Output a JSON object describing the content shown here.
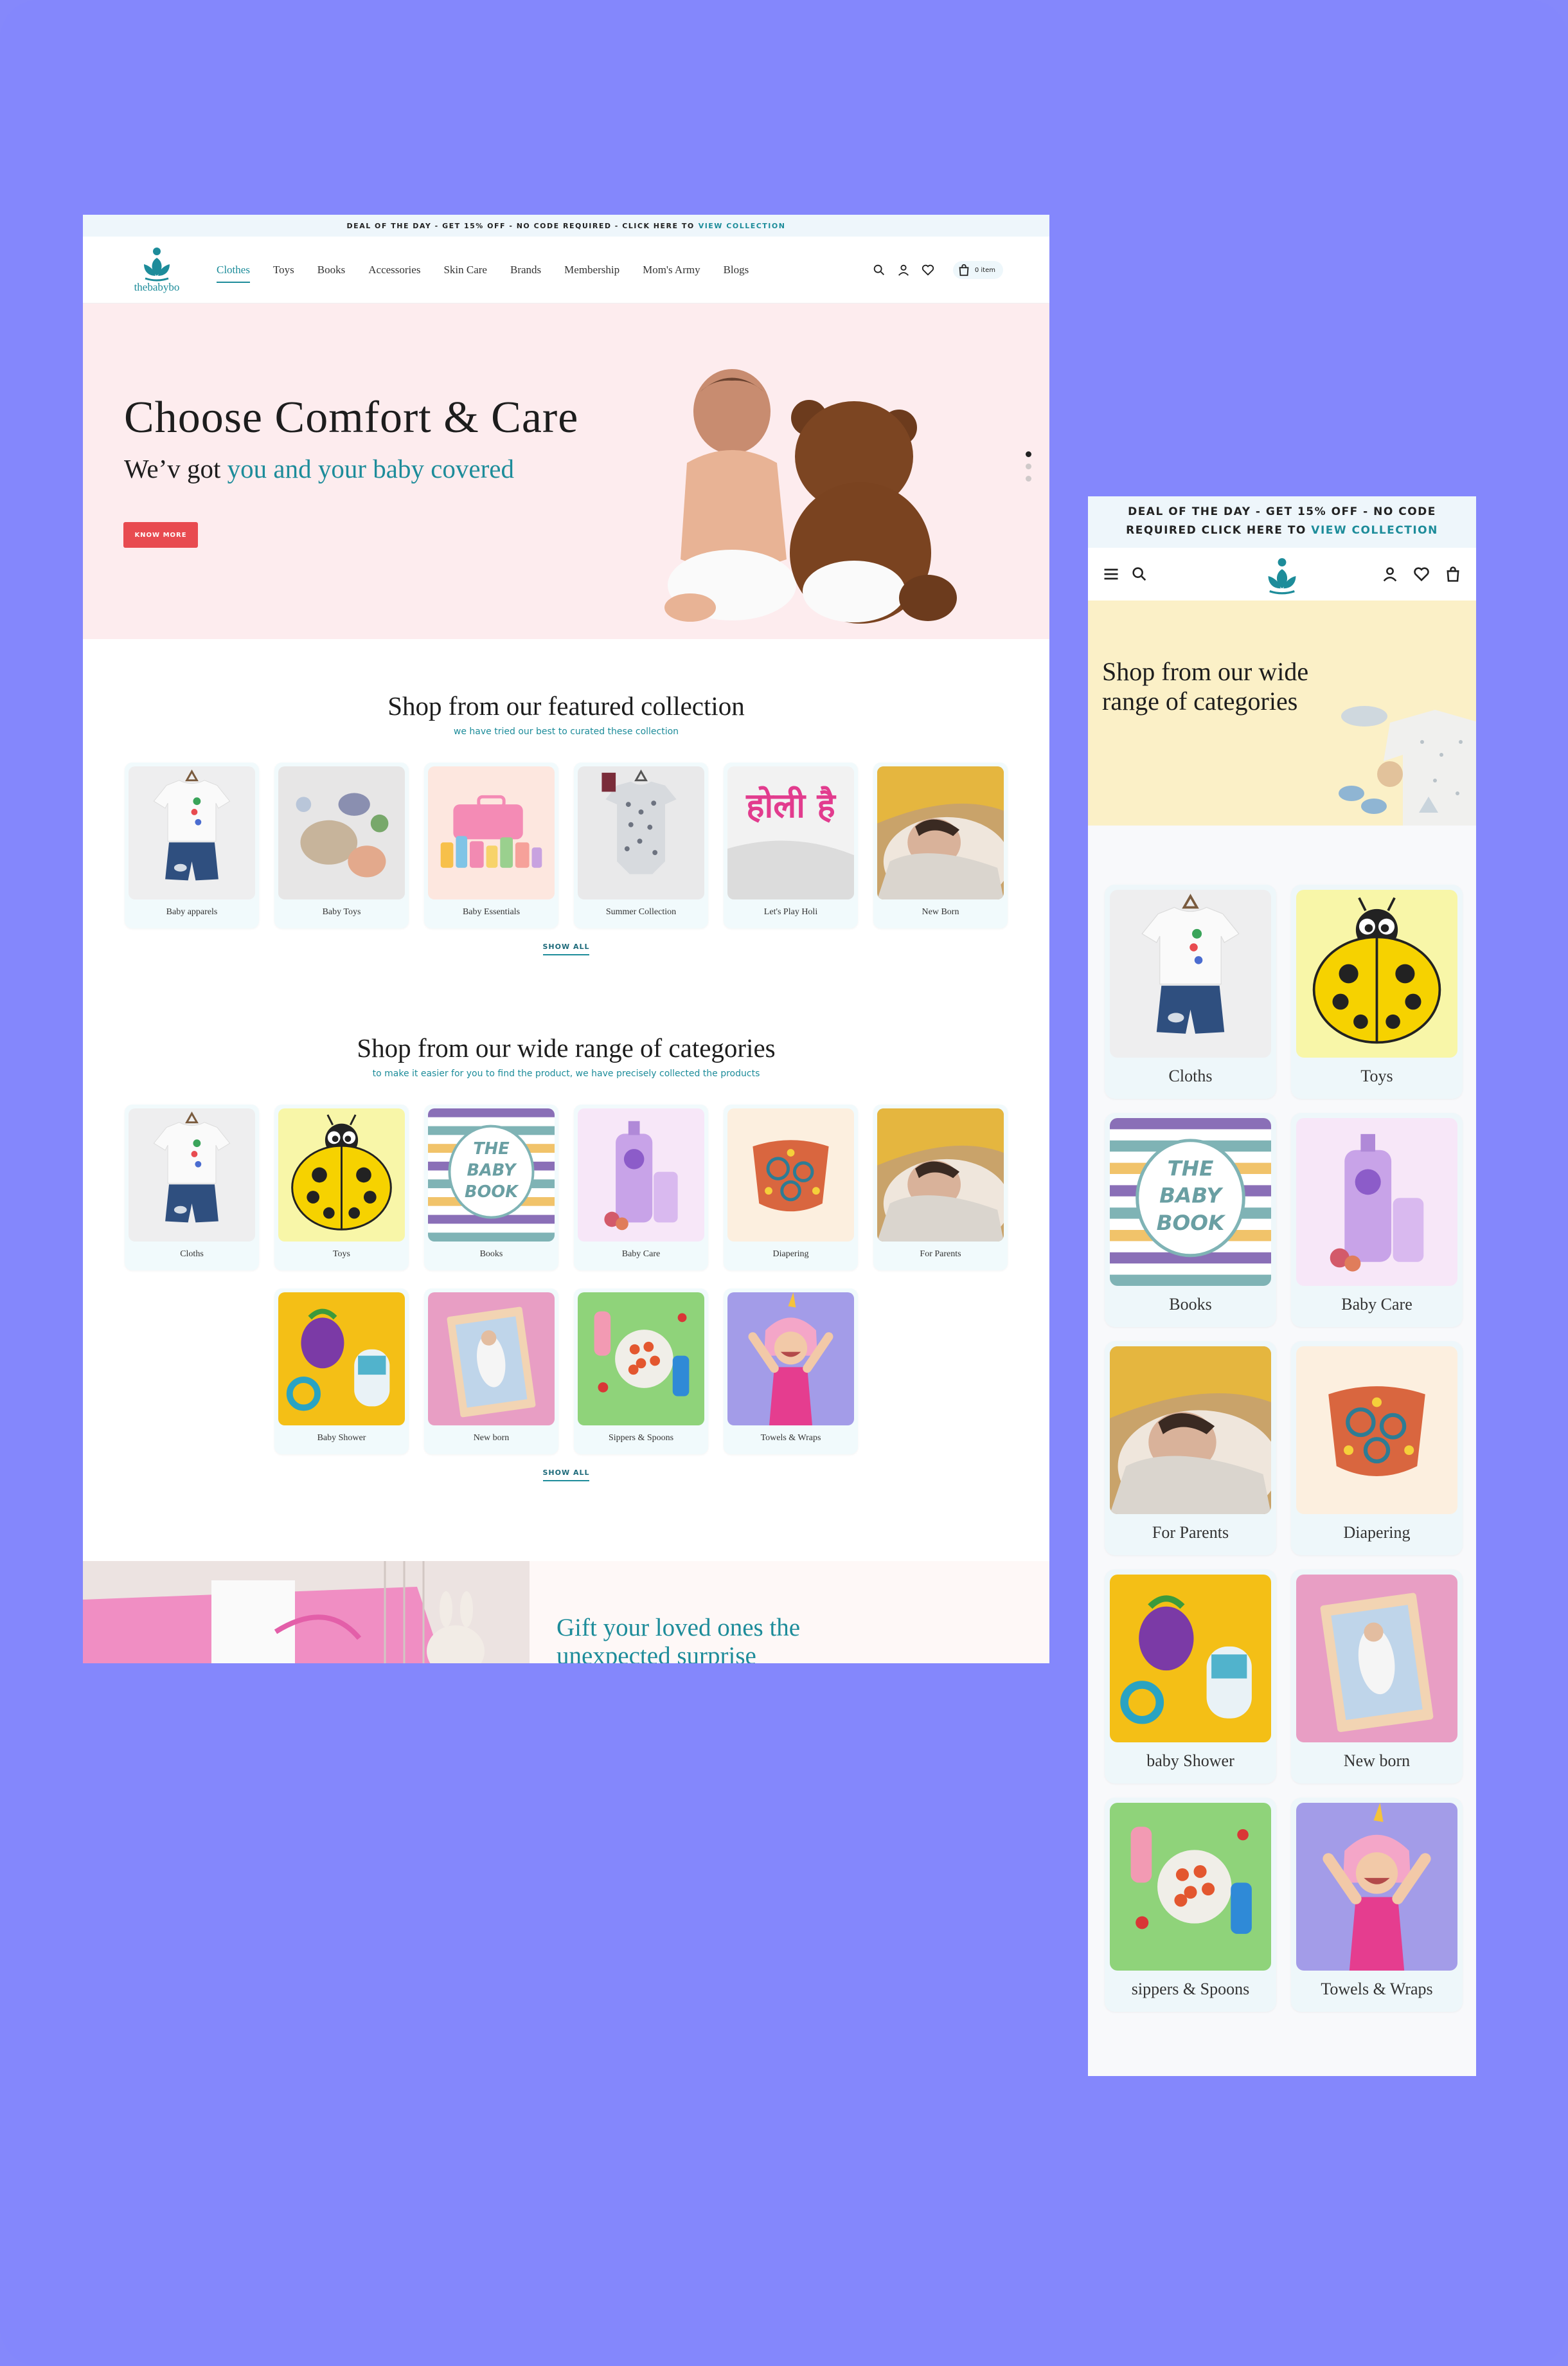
{
  "colors": {
    "background": "#8588fb",
    "brand_teal": "#1d8c9a",
    "cta_red": "#e84b50",
    "hero_pink": "#fdecee",
    "hero_yellow": "#fbf0c7"
  },
  "desktop": {
    "announcement": {
      "text": "DEAL OF THE DAY - GET 15% OFF - NO CODE REQUIRED - CLICK HERE TO",
      "link": "VIEW COLLECTION"
    },
    "logo_text": "thebabybo",
    "nav": [
      "Clothes",
      "Toys",
      "Books",
      "Accessories",
      "Skin Care",
      "Brands",
      "Membership",
      "Mom's Army",
      "Blogs"
    ],
    "cart_label": "0 item",
    "icons": [
      "search-icon",
      "user-icon",
      "heart-icon",
      "bag-icon"
    ],
    "hero": {
      "title": "Choose Comfort & Care",
      "subtitle_lead": "We’v got",
      "subtitle_highlight": "you and your baby covered",
      "cta": "KNOW MORE"
    },
    "featured": {
      "title": "Shop from our featured collection",
      "subtitle": "we have tried our best to curated these collection",
      "items": [
        "Baby apparels",
        "Baby Toys",
        "Baby Essentials",
        "Summer Collection",
        "Let's Play Holi",
        "New Born"
      ],
      "show_all": "SHOW ALL"
    },
    "categories": {
      "title": "Shop from our wide range of categories",
      "subtitle": "to make it easier for you to find the product, we have precisely collected the products",
      "row1": [
        "Cloths",
        "Toys",
        "Books",
        "Baby Care",
        "Diapering",
        "For Parents"
      ],
      "row2": [
        "Baby Shower",
        "New born",
        "Sippers & Spoons",
        "Towels & Wraps"
      ],
      "show_all": "SHOW ALL"
    },
    "gift": {
      "line1": "Gift your loved ones the",
      "line2": "unexpected surprise"
    },
    "holi_text": "होली है"
  },
  "mobile": {
    "announcement": {
      "line1": "DEAL OF THE DAY - GET 15% OFF - NO CODE",
      "line2": "REQUIRED CLICK HERE TO",
      "link": "VIEW COLLECTION"
    },
    "hero_title_1": "Shop from our wide",
    "hero_title_2": "range of categories",
    "categories": [
      "Cloths",
      "Toys",
      "Books",
      "Baby Care",
      "For Parents",
      "Diapering",
      "baby Shower",
      "New born",
      "sippers & Spoons",
      "Towels & Wraps"
    ]
  },
  "book_cover": {
    "line1": "THE",
    "line2": "BABY",
    "line3": "BOOK"
  }
}
